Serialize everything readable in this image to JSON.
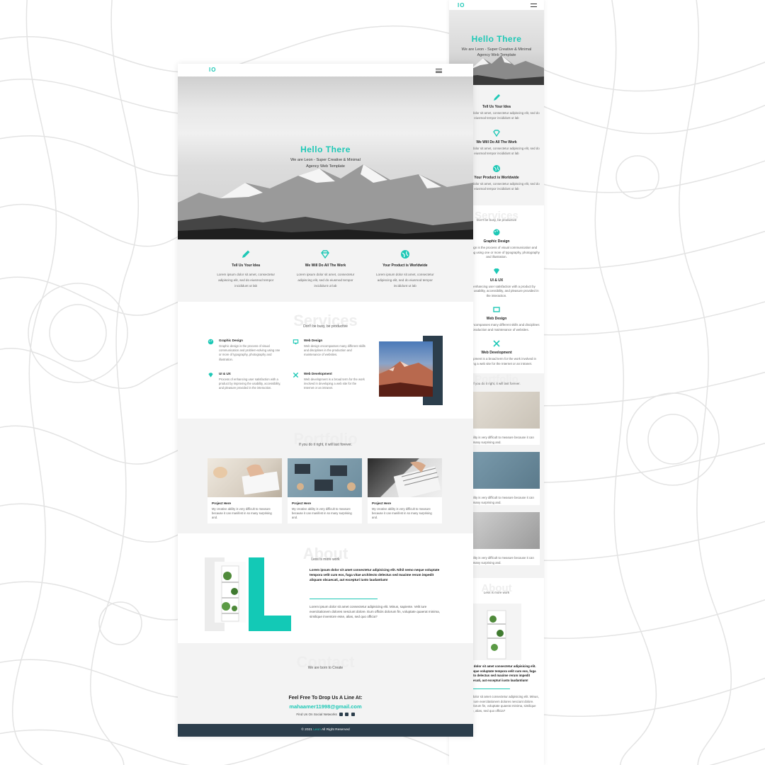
{
  "brand": {
    "logo": "IO",
    "accent": "#1ec8b6",
    "dark": "#2c3e4c"
  },
  "hero": {
    "title": "Hello There",
    "subtitle": "We are Leon - Super Creative & Minimal Agency Web Template"
  },
  "features": [
    {
      "icon": "pencil-icon",
      "title": "Tell Us Your Idea",
      "text": "Lorem ipsum dolor sit amet, consectetur adipiscing elit, sed do eiusmod tempor incididunt ut lab"
    },
    {
      "icon": "diamond-icon",
      "title": "We Will Do All The Work",
      "text": "Lorem ipsum dolor sit amet, consectetur adipiscing elit, sed do eiusmod tempor incididunt ut lab"
    },
    {
      "icon": "globe-icon",
      "title": "Your Product is Worldwide",
      "text": "Lorem ipsum dolor sit amet, consectetur adipiscing elit, sed do eiusmod tempor incididunt ut lab"
    }
  ],
  "services": {
    "heading": "Services",
    "tagline": "Don't be busy, be productive",
    "items": [
      {
        "icon": "palette-icon",
        "title": "Graphic Design",
        "text": "Graphic design is the process of visual communication and problem-solving using one or more of typography, photography and illustration."
      },
      {
        "icon": "monitor-icon",
        "title": "Web Design",
        "text": "Web design encompasses many different skills and disciplines in the production and maintenance of websites."
      },
      {
        "icon": "diamond-icon",
        "title": "UI & UX",
        "text": "Process of enhancing user satisfaction with a product by improving the usability, accessibility, and pleasure provided in the interaction."
      },
      {
        "icon": "code-icon",
        "title": "Web Development",
        "text": "Web development is a broad term for the work involved in developing a web site for the Internet or an intranet."
      }
    ]
  },
  "portfolio": {
    "heading": "Portfolio",
    "tagline": "If you do it right, it will last forever.",
    "projects": [
      {
        "title": "Project Here",
        "text": "My creative ability is very difficult to measure because it can manifest in so many surprising and."
      },
      {
        "title": "Project Here",
        "text": "My creative ability is very difficult to measure because it can manifest in so many surprising and."
      },
      {
        "title": "Project Here",
        "text": "My creative ability is very difficult to measure because it can manifest in so many surprising and."
      }
    ]
  },
  "about": {
    "heading": "About",
    "tagline": "Less is more work",
    "bold_text": "Lorem ipsum dolor sit amet consectetur adipisicing elit. Nihil nemo neque voluptate tempora velit cum eos, fuga vitae architecto delectus sed maxime rerum impedit aliquam obcaecati, aut excepturi iusto laudantium!",
    "text": "Lorem ipsum dolor sit amet consectetur adipisicing elit. Minus, sapiente. Velit iure exercitationem dolores nesciunt dolore. Eum officiis dolorum fin, voluptate quaerat minima, similique inventore esse, alias, sed quo officia?"
  },
  "contact": {
    "heading": "Contact",
    "tagline": "We are born to Create",
    "cta": "Feel Free To Drop Us A Line At:",
    "email": "mahaamer11998@gmail.com",
    "social_label": "Find Us On Social Networks"
  },
  "footer": {
    "prefix": "© 2021",
    "brand": "Leon",
    "suffix": "All Right Reserved"
  },
  "mobile": {
    "services_shown": [
      "Graphic Design",
      "UI & UX",
      "Web Design",
      "Web Development"
    ],
    "feature_texts_partial": "Lorem ipsum dolor sit amet, consectetur adipiscing elit, sed do eiusmod tempor incididunt ut lab"
  }
}
